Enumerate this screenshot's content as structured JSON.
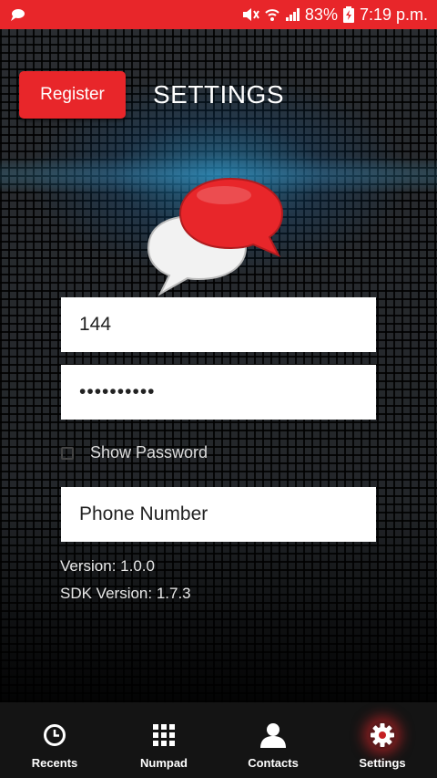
{
  "status_bar": {
    "battery": "83%",
    "time": "7:19 p.m."
  },
  "header": {
    "register_label": "Register",
    "title": "SETTINGS"
  },
  "form": {
    "username_value": "144",
    "password_value": "••••••••••",
    "show_password_label": "Show Password",
    "show_password_checked": false,
    "phone_placeholder": "Phone Number"
  },
  "info": {
    "version": "Version: 1.0.0",
    "sdk_version": "SDK Version: 1.7.3"
  },
  "nav": {
    "items": [
      {
        "label": "Recents",
        "icon": "clock-icon"
      },
      {
        "label": "Numpad",
        "icon": "numpad-grid-icon"
      },
      {
        "label": "Contacts",
        "icon": "person-icon"
      },
      {
        "label": "Settings",
        "icon": "gear-icon",
        "active": true
      }
    ]
  },
  "colors": {
    "accent": "#e8262a",
    "nav_background": "#141414"
  }
}
